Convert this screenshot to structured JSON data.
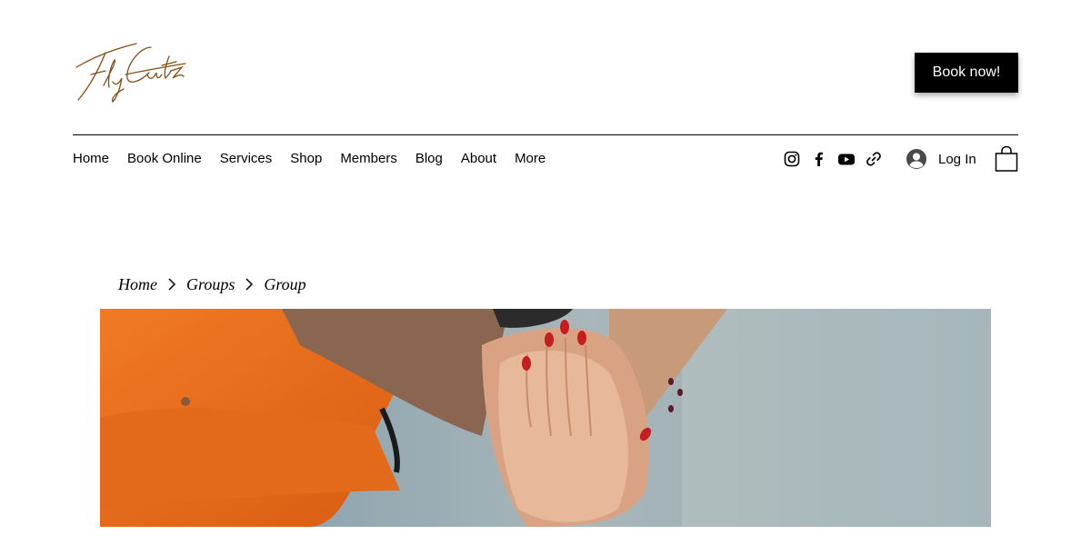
{
  "header": {
    "logo_text": "Fly Cutz",
    "book_button_label": "Book now!",
    "colors": {
      "logo": "#8a4b12",
      "button_bg": "#000000",
      "button_text": "#ffffff"
    }
  },
  "nav": {
    "items": [
      {
        "label": "Home"
      },
      {
        "label": "Book Online"
      },
      {
        "label": "Services"
      },
      {
        "label": "Shop"
      },
      {
        "label": "Members"
      },
      {
        "label": "Blog"
      },
      {
        "label": "About"
      },
      {
        "label": "More"
      }
    ]
  },
  "social": {
    "icons": [
      "instagram-icon",
      "facebook-icon",
      "youtube-icon",
      "link-icon"
    ]
  },
  "login": {
    "label": "Log In",
    "icon": "user-avatar-icon"
  },
  "cart": {
    "icon": "shopping-bag-icon"
  },
  "breadcrumb": {
    "items": [
      {
        "label": "Home"
      },
      {
        "label": "Groups"
      },
      {
        "label": "Group"
      }
    ],
    "separator_icon": "chevron-right-icon"
  },
  "hero": {
    "image_subject": "stacked-hands-photo"
  }
}
